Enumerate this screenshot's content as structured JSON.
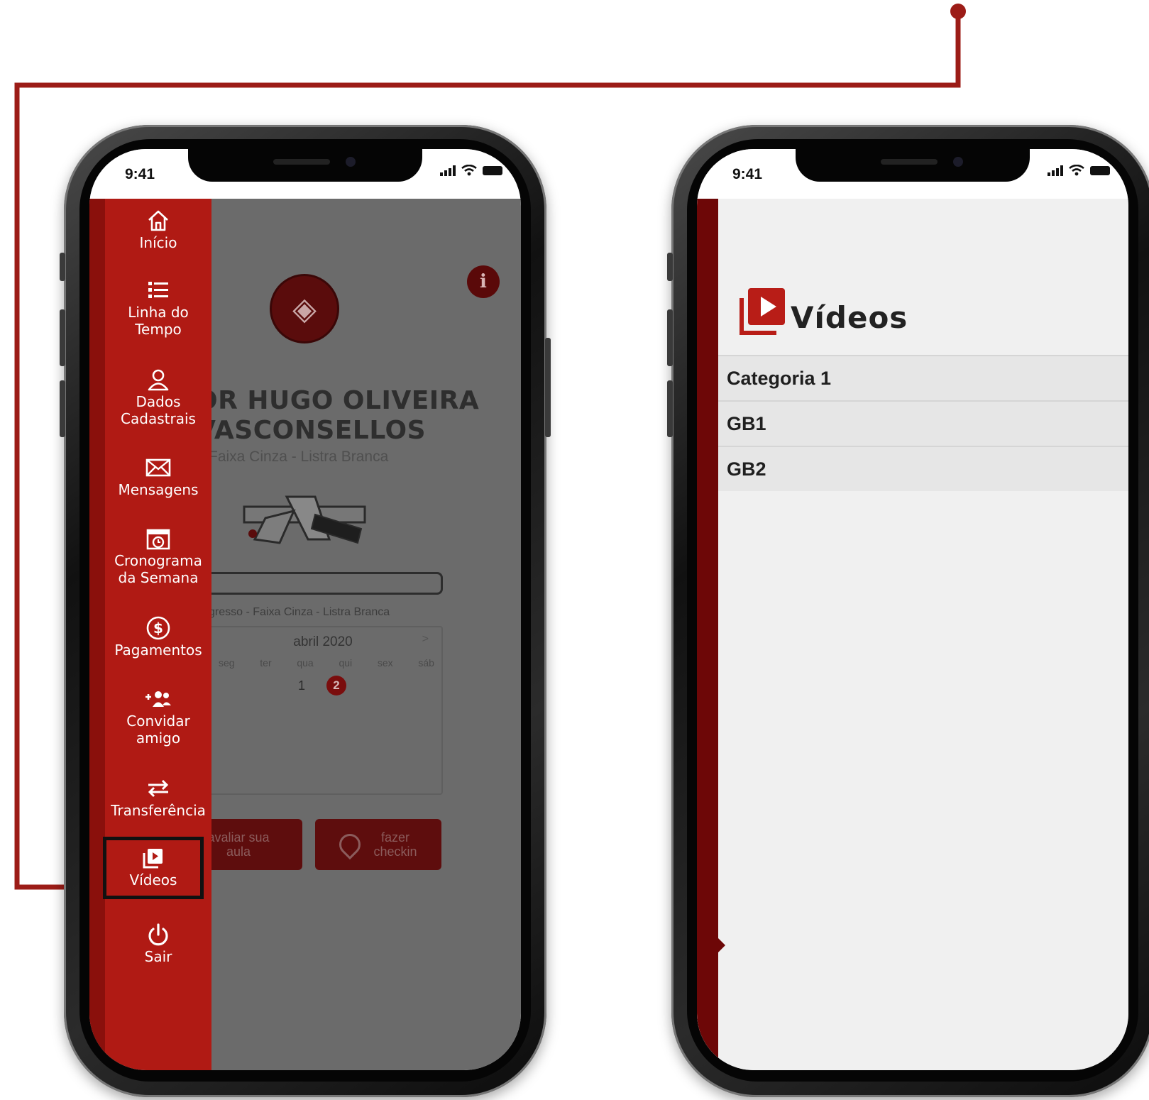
{
  "colors": {
    "brand_red": "#b01a14",
    "dark_red": "#6d0707",
    "connector": "#9c1c17"
  },
  "left_phone": {
    "status_time": "9:41",
    "drawer": {
      "items": [
        {
          "label": "Início",
          "icon": "home-icon"
        },
        {
          "label": "Linha do\nTempo",
          "icon": "list-icon"
        },
        {
          "label": "Dados\nCadastrais",
          "icon": "user-icon"
        },
        {
          "label": "Mensagens",
          "icon": "mail-icon"
        },
        {
          "label": "Cronograma\nda Semana",
          "icon": "calendar-clock-icon"
        },
        {
          "label": "Pagamentos",
          "icon": "dollar-icon"
        },
        {
          "label": "Convidar\namigo",
          "icon": "add-friend-icon"
        },
        {
          "label": "Transferência",
          "icon": "transfer-icon"
        },
        {
          "label": "Vídeos",
          "icon": "video-icon",
          "active": true
        },
        {
          "label": "Sair",
          "icon": "power-icon"
        }
      ]
    },
    "profile": {
      "name": "OR HUGO OLIVEIRA\nVASCONSELLOS",
      "belt": "Faixa Cinza - Listra Branca",
      "progress_text": "gresso - Faixa Cinza - Listra Branca",
      "info_icon": "info-icon"
    },
    "calendar": {
      "month": "abril 2020",
      "next": ">",
      "weekdays": [
        "seg",
        "ter",
        "qua",
        "qui",
        "sex",
        "sáb"
      ],
      "day1": "1",
      "day2": "2"
    },
    "buttons": {
      "rate": "avaliar sua\naula",
      "checkin": "fazer\ncheckin"
    }
  },
  "right_phone": {
    "status_time": "9:41",
    "title": "Vídeos",
    "categories": [
      "Categoria 1",
      "GB1",
      "GB2"
    ]
  }
}
